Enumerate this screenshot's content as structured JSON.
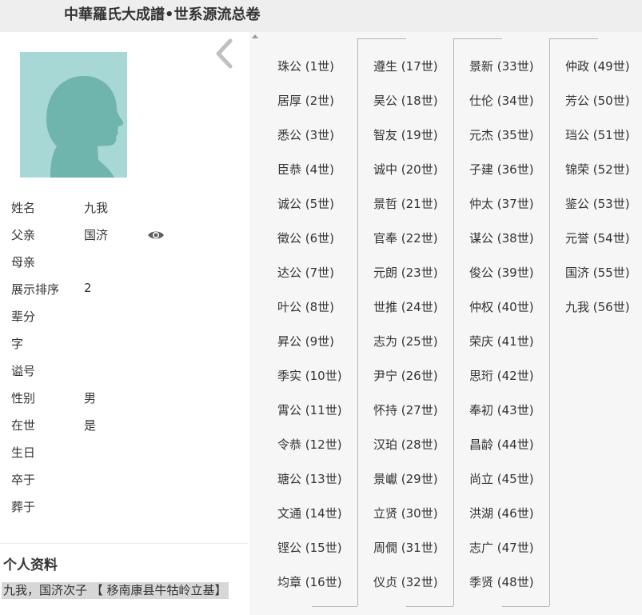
{
  "header": {
    "title": "中華羅氏大成譜•世系源流总卷"
  },
  "person": {
    "fields": [
      {
        "label": "姓名",
        "value": "九我"
      },
      {
        "label": "父亲",
        "value": "国济"
      },
      {
        "label": "母亲",
        "value": ""
      },
      {
        "label": "展示排序",
        "value": "2"
      },
      {
        "label": "辈分",
        "value": ""
      },
      {
        "label": "字",
        "value": ""
      },
      {
        "label": "谥号",
        "value": ""
      },
      {
        "label": "性别",
        "value": "男"
      },
      {
        "label": "在世",
        "value": "是"
      },
      {
        "label": "生日",
        "value": ""
      },
      {
        "label": "卒于",
        "value": ""
      },
      {
        "label": "葬于",
        "value": ""
      }
    ],
    "icons": {
      "back": "chevron-left-icon",
      "avatar": "avatar-silhouette-icon",
      "father_view": "eye-icon"
    }
  },
  "profile": {
    "title": "个人资料",
    "text": "九我，国济次子 【 移南康县牛牯岭立基】"
  },
  "lineage": {
    "columns": [
      [
        "珠公 (1世)",
        "居厚 (2世)",
        "悉公 (3世)",
        "臣恭 (4世)",
        "诚公 (5世)",
        "徵公 (6世)",
        "达公 (7世)",
        "叶公 (8世)",
        "昇公 (9世)",
        "季实 (10世)",
        "霄公 (11世)",
        "令恭 (12世)",
        "瑭公 (13世)",
        "文通 (14世)",
        "铿公 (15世)",
        "均章 (16世)"
      ],
      [
        "遵生 (17世)",
        "昊公 (18世)",
        "智友 (19世)",
        "诚中 (20世)",
        "景哲 (21世)",
        "官奉 (22世)",
        "元朗 (23世)",
        "世推 (24世)",
        "志为 (25世)",
        "尹宁 (26世)",
        "怀持 (27世)",
        "汉珀 (28世)",
        "景巘 (29世)",
        "立贤 (30世)",
        "周僩 (31世)",
        "仪贞 (32世)"
      ],
      [
        "景新 (33世)",
        "仕伦 (34世)",
        "元杰 (35世)",
        "子建 (36世)",
        "仲太 (37世)",
        "谋公 (38世)",
        "俊公 (39世)",
        "仲权 (40世)",
        "荣庆 (41世)",
        "思珩 (42世)",
        "奉初 (43世)",
        "昌龄 (44世)",
        "尚立 (45世)",
        "洪湖 (46世)",
        "志广 (47世)",
        "季贤 (48世)"
      ],
      [
        "仲政 (49世)",
        "芳公 (50世)",
        "珰公 (51世)",
        "锦荣 (52世)",
        "鉴公 (53世)",
        "元誉 (54世)",
        "国济 (55世)",
        "九我 (56世)"
      ]
    ]
  },
  "colors": {
    "header_bg": "#eeeeee",
    "panel_bg": "#f6f6f6",
    "avatar_bg": "#a7d8d6",
    "silhouette": "#6fb5ad",
    "highlight": "#d7d7d7"
  }
}
